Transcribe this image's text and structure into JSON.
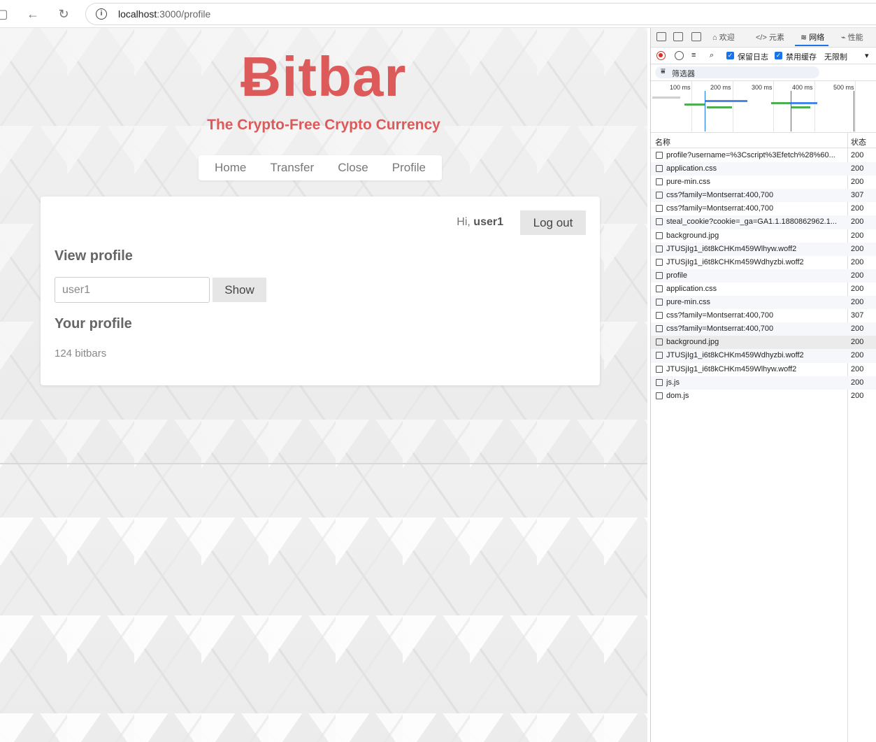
{
  "browser": {
    "url_host": "localhost",
    "url_rest": ":3000/profile"
  },
  "site": {
    "logo": "Ƀitbar",
    "tagline": "The Crypto-Free Crypto Currency",
    "nav": [
      "Home",
      "Transfer",
      "Close",
      "Profile"
    ],
    "greeting_prefix": "Hi, ",
    "username": "user1",
    "logout_label": "Log out",
    "view_profile_heading": "View profile",
    "username_input_value": "user1",
    "show_label": "Show",
    "your_profile_heading": "Your profile",
    "balance_text": "124 bitbars"
  },
  "devtools": {
    "tabs": [
      "欢迎",
      "元素",
      "网络",
      "性能"
    ],
    "active_tab": "网络",
    "toolbar": {
      "preserve_log": "保留日志",
      "disable_cache": "禁用缓存",
      "throttle": "无限制"
    },
    "filter_label": "筛选器",
    "timeline_ticks": [
      "100 ms",
      "200 ms",
      "300 ms",
      "400 ms",
      "500 ms"
    ],
    "columns": {
      "name": "名称",
      "status": "状态"
    },
    "requests": [
      {
        "name": "profile?username=%3Cscript%3Efetch%28%60...",
        "status": "200"
      },
      {
        "name": "application.css",
        "status": "200"
      },
      {
        "name": "pure-min.css",
        "status": "200"
      },
      {
        "name": "css?family=Montserrat:400,700",
        "status": "307"
      },
      {
        "name": "css?family=Montserrat:400,700",
        "status": "200"
      },
      {
        "name": "steal_cookie?cookie=_ga=GA1.1.1880862962.1...",
        "status": "200"
      },
      {
        "name": "background.jpg",
        "status": "200"
      },
      {
        "name": "JTUSjIg1_i6t8kCHKm459Wlhyw.woff2",
        "status": "200"
      },
      {
        "name": "JTUSjIg1_i6t8kCHKm459Wdhyzbi.woff2",
        "status": "200"
      },
      {
        "name": "profile",
        "status": "200"
      },
      {
        "name": "application.css",
        "status": "200"
      },
      {
        "name": "pure-min.css",
        "status": "200"
      },
      {
        "name": "css?family=Montserrat:400,700",
        "status": "307"
      },
      {
        "name": "css?family=Montserrat:400,700",
        "status": "200"
      },
      {
        "name": "background.jpg",
        "status": "200"
      },
      {
        "name": "JTUSjIg1_i6t8kCHKm459Wdhyzbi.woff2",
        "status": "200"
      },
      {
        "name": "JTUSjIg1_i6t8kCHKm459Wlhyw.woff2",
        "status": "200"
      },
      {
        "name": "js.js",
        "status": "200"
      },
      {
        "name": "dom.js",
        "status": "200"
      }
    ]
  }
}
